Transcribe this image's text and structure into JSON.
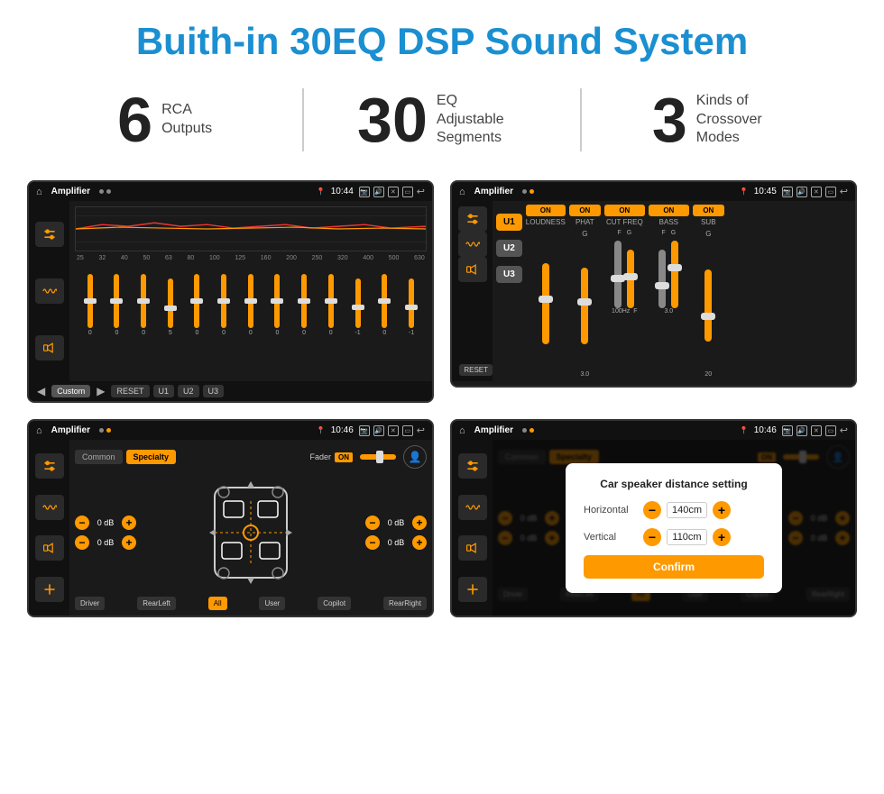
{
  "header": {
    "title": "Buith-in 30EQ DSP Sound System"
  },
  "stats": [
    {
      "number": "6",
      "text_line1": "RCA",
      "text_line2": "Outputs"
    },
    {
      "number": "30",
      "text_line1": "EQ Adjustable",
      "text_line2": "Segments"
    },
    {
      "number": "3",
      "text_line1": "Kinds of",
      "text_line2": "Crossover Modes"
    }
  ],
  "screens": {
    "eq": {
      "status_bar": {
        "title": "Amplifier",
        "time": "10:44"
      },
      "freq_labels": [
        "25",
        "32",
        "40",
        "50",
        "63",
        "80",
        "100",
        "125",
        "160",
        "200",
        "250",
        "320",
        "400",
        "500",
        "630"
      ],
      "slider_values": [
        "0",
        "0",
        "0",
        "5",
        "0",
        "0",
        "0",
        "0",
        "0",
        "0",
        "-1",
        "0",
        "-1"
      ],
      "bottom_buttons": [
        "Custom",
        "RESET",
        "U1",
        "U2",
        "U3"
      ]
    },
    "crossover": {
      "status_bar": {
        "title": "Amplifier",
        "time": "10:45"
      },
      "u_buttons": [
        "U1",
        "U2",
        "U3"
      ],
      "channels": [
        {
          "name": "LOUDNESS",
          "on": true
        },
        {
          "name": "PHAT",
          "on": true
        },
        {
          "name": "CUT FREQ",
          "on": true
        },
        {
          "name": "BASS",
          "on": true
        },
        {
          "name": "SUB",
          "on": true
        }
      ],
      "reset_label": "RESET"
    },
    "fader": {
      "status_bar": {
        "title": "Amplifier",
        "time": "10:46"
      },
      "tabs": [
        "Common",
        "Specialty"
      ],
      "active_tab": "Specialty",
      "fader_label": "Fader",
      "on_label": "ON",
      "db_values": [
        "0 dB",
        "0 dB",
        "0 dB",
        "0 dB"
      ],
      "bottom_buttons": [
        "Driver",
        "All",
        "User",
        "Copilot",
        "RearLeft",
        "RearRight"
      ]
    },
    "distance": {
      "status_bar": {
        "title": "Amplifier",
        "time": "10:46"
      },
      "tabs": [
        "Common",
        "Specialty"
      ],
      "active_tab": "Specialty",
      "on_label": "ON",
      "modal": {
        "title": "Car speaker distance setting",
        "horizontal_label": "Horizontal",
        "horizontal_value": "140cm",
        "vertical_label": "Vertical",
        "vertical_value": "110cm",
        "confirm_label": "Confirm"
      },
      "db_values": [
        "0 dB",
        "0 dB"
      ],
      "bottom_buttons": [
        "Driver",
        "RearLeft",
        "User",
        "Copilot",
        "RearRight"
      ]
    }
  }
}
